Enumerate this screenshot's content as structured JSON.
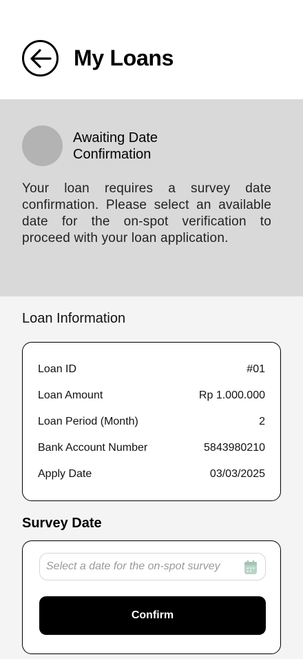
{
  "header": {
    "title": "My Loans",
    "back_icon": "arrow-left-icon"
  },
  "status": {
    "title": "Awaiting Date Confirmation",
    "description": "Your loan requires a survey date confirmation. Please select an available date for the on-spot verification to proceed with your loan application."
  },
  "loan_info": {
    "section_title": "Loan Information",
    "rows": [
      {
        "label": "Loan ID",
        "value": "#01"
      },
      {
        "label": "Loan Amount",
        "value": "Rp 1.000.000"
      },
      {
        "label": "Loan Period (Month)",
        "value": "2"
      },
      {
        "label": "Bank Account Number",
        "value": "5843980210"
      },
      {
        "label": "Apply Date",
        "value": "03/03/2025"
      }
    ]
  },
  "survey": {
    "section_title": "Survey Date",
    "placeholder": "Select a date for the on-spot survey",
    "calendar_icon": "calendar-icon",
    "confirm_label": "Confirm"
  },
  "colors": {
    "status_bg": "#d9d9d9",
    "avatar": "#b3b3b3",
    "page_bg": "#f4f4f4",
    "button": "#000000",
    "calendar_icon": "#b9d3c7"
  }
}
